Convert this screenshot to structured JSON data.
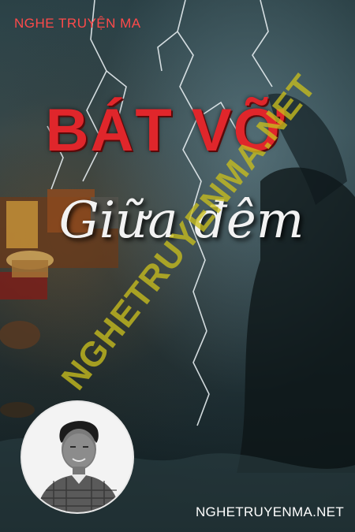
{
  "cover": {
    "brand_top": "NGHE TRUYỆN MA",
    "title_main": "BÁT VỠ",
    "title_sub": "Giữa đêm",
    "watermark": "NGHETRUYENMA.NET",
    "brand_bottom": "NGHETRUYENMA.NET"
  },
  "colors": {
    "title_red": "#e0262b",
    "watermark_yellow": "#c8be1e",
    "brand_red": "#ff4a4a"
  }
}
